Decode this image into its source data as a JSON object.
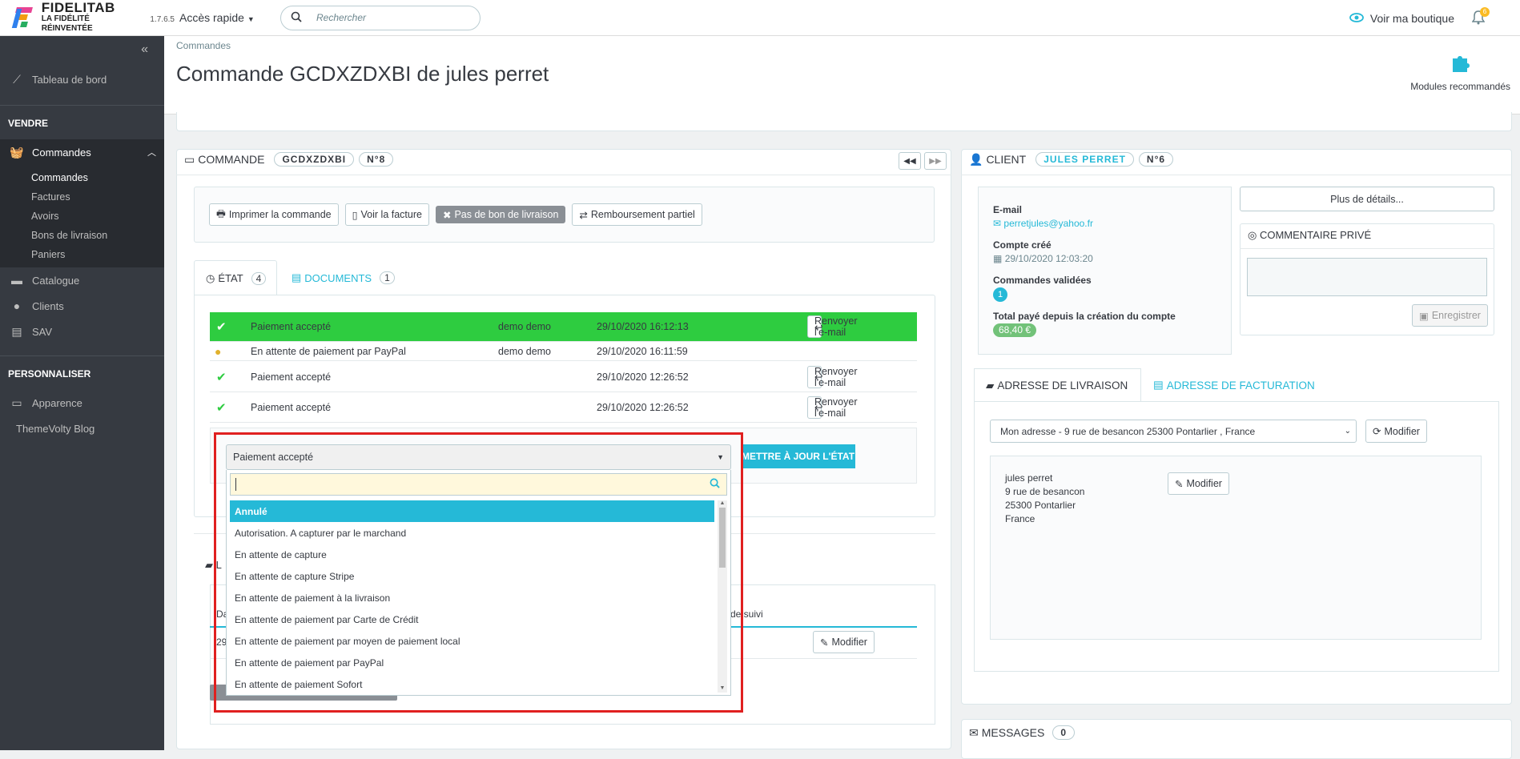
{
  "brand": {
    "name": "FIDELITAB",
    "tagline": "LA FIDÉLITÉ RÉINVENTÉE",
    "version": "1.7.6.5"
  },
  "topbar": {
    "quick_access": "Accès rapide",
    "search_placeholder": "Rechercher",
    "view_shop": "Voir ma boutique",
    "notif_count": "6"
  },
  "sidebar": {
    "dashboard": "Tableau de bord",
    "section_sell": "VENDRE",
    "orders": "Commandes",
    "sub": [
      "Commandes",
      "Factures",
      "Avoirs",
      "Bons de livraison",
      "Paniers"
    ],
    "catalog": "Catalogue",
    "clients": "Clients",
    "sav": "SAV",
    "section_custom": "PERSONNALISER",
    "appearance": "Apparence",
    "blog": "ThemeVolty Blog"
  },
  "header": {
    "breadcrumb": "Commandes",
    "title": "Commande GCDXZDXBI de jules perret",
    "modules": "Modules recommandés"
  },
  "order": {
    "label": "COMMANDE",
    "ref": "GCDXZDXBI",
    "num": "N°8",
    "btn_print": "Imprimer la commande",
    "btn_invoice": "Voir la facture",
    "btn_no_delivery": "Pas de bon de livraison",
    "btn_refund": "Remboursement partiel",
    "tab_state": "ÉTAT",
    "tab_state_count": "4",
    "tab_docs": "DOCUMENTS",
    "tab_docs_count": "1"
  },
  "history": [
    {
      "status": "Paiement accepté",
      "user": "demo demo",
      "date": "29/10/2020 16:12:13",
      "action": "Renvoyer l'e-mail"
    },
    {
      "status": "En attente de paiement par PayPal",
      "user": "demo demo",
      "date": "29/10/2020 16:11:59",
      "action": ""
    },
    {
      "status": "Paiement accepté",
      "user": "",
      "date": "29/10/2020 12:26:52",
      "action": "Renvoyer l'e-mail"
    },
    {
      "status": "Paiement accepté",
      "user": "",
      "date": "29/10/2020 12:26:52",
      "action": "Renvoyer l'e-mail"
    }
  ],
  "state_select": {
    "value": "Paiement accepté",
    "update_btn": "METTRE À JOUR L'ÉTAT",
    "options": [
      "Annulé",
      "Autorisation. A capturer par le marchand",
      "En attente de capture",
      "En attente de capture Stripe",
      "En attente de paiement à la livraison",
      "En attente de paiement par Carte de Crédit",
      "En attente de paiement par moyen de paiement local",
      "En attente de paiement par PayPal",
      "En attente de paiement Sofort"
    ]
  },
  "shipping": {
    "col_tracking": "de suivi",
    "row_date": "29",
    "modify": "Modifier",
    "partial_heading": "L"
  },
  "client": {
    "label": "CLIENT",
    "name": "JULES PERRET",
    "num": "N°6",
    "email_label": "E-mail",
    "email": "perretjules@yahoo.fr",
    "created_label": "Compte créé",
    "created": "29/10/2020 12:03:20",
    "orders_label": "Commandes validées",
    "orders_count": "1",
    "total_label": "Total payé depuis la création du compte",
    "total": "68,40 €",
    "more": "Plus de détails...",
    "comment_title": "COMMENTAIRE PRIVÉ",
    "save": "Enregistrer"
  },
  "address": {
    "tab_delivery": "ADRESSE DE LIVRAISON",
    "tab_invoice": "ADRESSE DE FACTURATION",
    "select": "Mon adresse - 9 rue de besancon 25300 Pontarlier , France",
    "modify": "Modifier",
    "lines": [
      "jules perret",
      "9 rue de besancon",
      "25300 Pontarlier",
      "France"
    ]
  },
  "messages": {
    "label": "MESSAGES",
    "count": "0"
  },
  "colors": {
    "accent": "#25b9d7",
    "green": "#2ecc40",
    "sidebar": "#363a41",
    "red": "#e02020"
  }
}
